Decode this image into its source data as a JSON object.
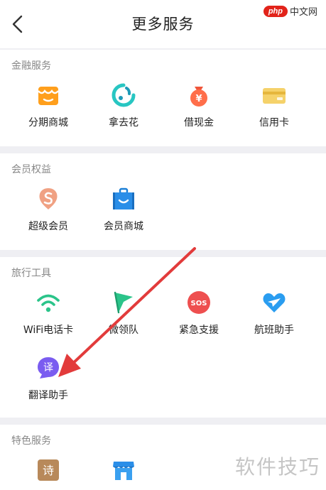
{
  "header": {
    "title": "更多服务",
    "brand_badge": "php",
    "brand_text": "中文网"
  },
  "sections": [
    {
      "title": "金融服务",
      "items": [
        {
          "label": "分期商城",
          "icon": "shop-icon"
        },
        {
          "label": "拿去花",
          "icon": "swirl-icon"
        },
        {
          "label": "借现金",
          "icon": "money-bag-icon"
        },
        {
          "label": "信用卡",
          "icon": "credit-card-icon"
        }
      ]
    },
    {
      "title": "会员权益",
      "items": [
        {
          "label": "超级会员",
          "icon": "balloon-icon"
        },
        {
          "label": "会员商城",
          "icon": "bag-icon"
        }
      ]
    },
    {
      "title": "旅行工具",
      "items": [
        {
          "label": "WiFi电话卡",
          "icon": "wifi-icon"
        },
        {
          "label": "微领队",
          "icon": "flag-icon"
        },
        {
          "label": "紧急支援",
          "icon": "sos-icon"
        },
        {
          "label": "航班助手",
          "icon": "plane-heart-icon"
        },
        {
          "label": "翻译助手",
          "icon": "translate-icon",
          "glyph": "译"
        }
      ]
    },
    {
      "title": "特色服务",
      "items": [
        {
          "label": "",
          "icon": "poem-icon",
          "glyph": "诗"
        },
        {
          "label": "",
          "icon": "store-icon"
        }
      ]
    }
  ],
  "sos_text": "SOS",
  "watermark": "软件技巧",
  "colors": {
    "background_gap": "#efeff3",
    "annotation_arrow": "#e23b3b",
    "section_title": "#888888"
  }
}
